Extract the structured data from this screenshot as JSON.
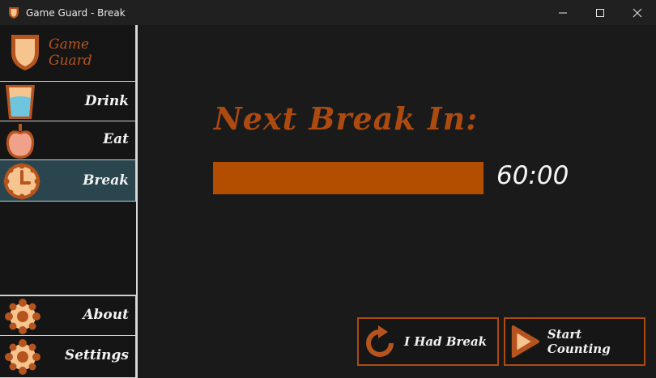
{
  "window": {
    "title": "Game Guard - Break"
  },
  "sidebar": {
    "brand": "Game Guard",
    "items": [
      {
        "label": "Drink",
        "icon": "water-glass-icon"
      },
      {
        "label": "Eat",
        "icon": "apple-icon"
      },
      {
        "label": "Break",
        "icon": "clock-icon",
        "active": true
      },
      {
        "label": "About",
        "icon": "gear-icon"
      },
      {
        "label": "Settings",
        "icon": "gear-icon"
      }
    ]
  },
  "main": {
    "heading": "Next Break In:",
    "progress_fraction": 1.0,
    "timer": "60:00",
    "buttons": {
      "had_break": "I Had Break",
      "start_counting": "Start Counting"
    }
  },
  "colors": {
    "accent": "#ad4a10",
    "progress_fill": "#b34d00",
    "active_item": "#2a454e",
    "background": "#1a1a1a"
  }
}
